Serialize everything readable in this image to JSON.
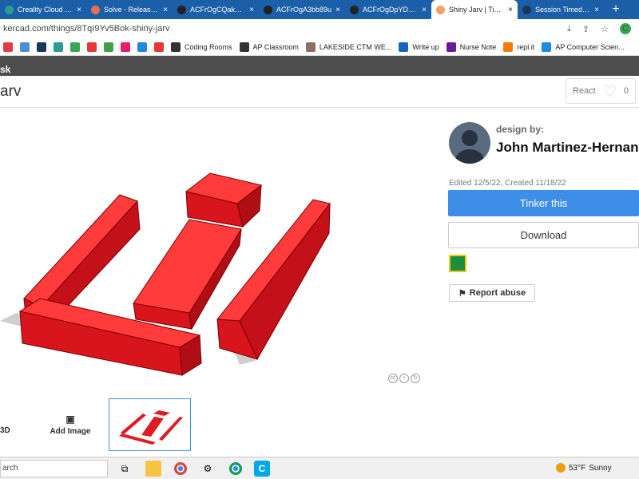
{
  "browser": {
    "tabs": [
      {
        "title": "Creality Cloud - A",
        "color": "#2a9d8f"
      },
      {
        "title": "Solve - Release F",
        "color": "#e76f51"
      },
      {
        "title": "ACFrOgCQakXmI",
        "color": "#222"
      },
      {
        "title": "ACFrOgA3bb89u",
        "color": "#222"
      },
      {
        "title": "ACFrOgDpYDzTC",
        "color": "#222"
      },
      {
        "title": "Shiny Jarv | Tinke",
        "color": "#f4a261"
      },
      {
        "title": "Session Timed Ou",
        "color": "#1d3557"
      }
    ],
    "active_tab_index": 5,
    "new_tab": "+",
    "url": "kercad.com/things/8TqI9Yv5Bok-shiny-jarv",
    "profile_initial": "C"
  },
  "bookmarks": [
    {
      "label": "",
      "color": "#e63946"
    },
    {
      "label": "",
      "color": "#4a90d9"
    },
    {
      "label": "",
      "color": "#1d3557"
    },
    {
      "label": "",
      "color": "#2a9d8f"
    },
    {
      "label": "",
      "color": "#34a853"
    },
    {
      "label": "",
      "color": "#e53935"
    },
    {
      "label": "",
      "color": "#43a047"
    },
    {
      "label": "",
      "color": "#e91e63"
    },
    {
      "label": "",
      "color": "#1e88e5"
    },
    {
      "label": "",
      "color": "#e53935"
    },
    {
      "label": "Coding Rooms",
      "color": "#333"
    },
    {
      "label": "AP Classroom",
      "color": "#333"
    },
    {
      "label": "LAKESIDE CTM WE...",
      "color": "#8d6e63"
    },
    {
      "label": "Write up",
      "color": "#1565c0"
    },
    {
      "label": "Nurse Note",
      "color": "#6a1b9a"
    },
    {
      "label": "repl.it",
      "color": "#f57c00"
    },
    {
      "label": "AP Computer Scien...",
      "color": "#1e88e5"
    }
  ],
  "site": {
    "strip_text": "sk"
  },
  "page": {
    "title": "arv"
  },
  "react": {
    "label": "React",
    "count": "0"
  },
  "designer": {
    "design_by_label": "design by:",
    "name": "John Martinez-Hernan",
    "edited": "Edited 12/5/22, Created 11/18/22"
  },
  "actions": {
    "tinker": "Tinker this",
    "download": "Download",
    "report": "Report abuse"
  },
  "thumbnails": {
    "3d_label": "3D",
    "add_image": "Add Image"
  },
  "taskbar": {
    "search": "arch",
    "temperature": "53°F",
    "condition": "Sunny"
  },
  "colors": {
    "accent": "#3d8ee6",
    "model_red": "#e01b24",
    "tab_bar": "#1b5fa8"
  }
}
